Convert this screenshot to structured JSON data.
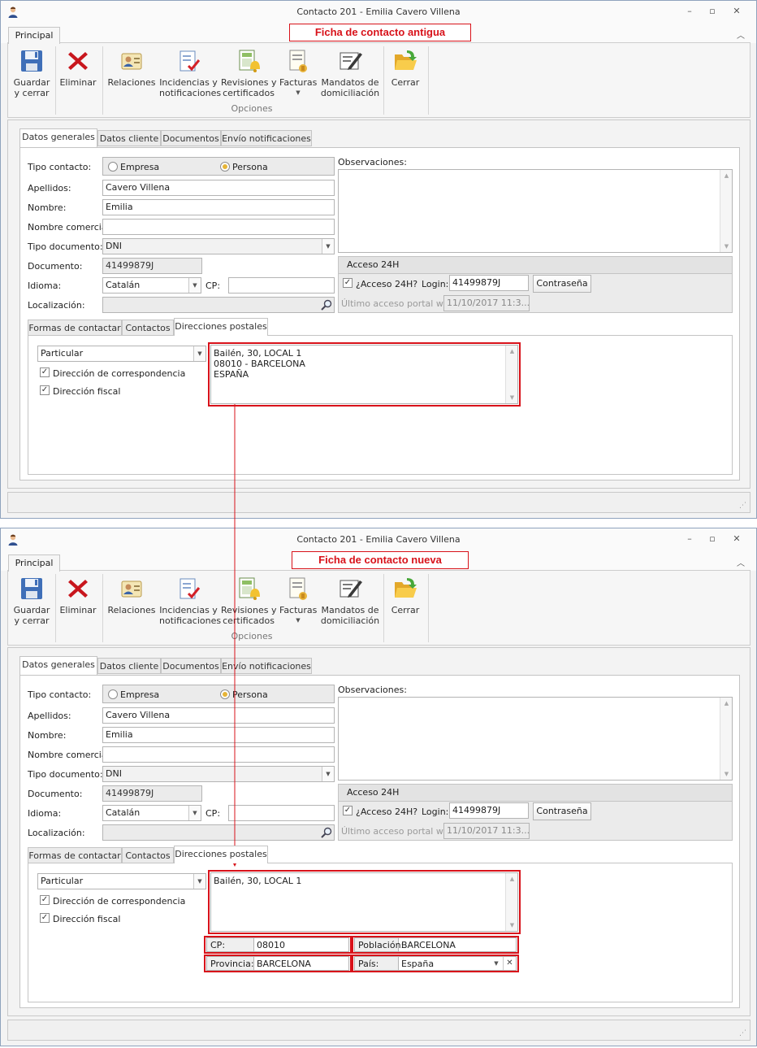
{
  "window_title": "Contacto 201 - Emilia Cavero Villena",
  "captions": {
    "old": "Ficha de contacto antigua",
    "new": "Ficha de contacto nueva"
  },
  "window_buttons": [
    "–",
    "▫",
    "✕"
  ],
  "ribbon": {
    "tab": "Principal",
    "buttons": {
      "save": "Guardar\ny cerrar",
      "delete": "Eliminar",
      "relations": "Relaciones",
      "incidents": "Incidencias y\nnotificaciones",
      "reviews": "Revisiones y\ncertificados",
      "invoices": "Facturas",
      "mandates": "Mandatos de\ndomiciliación",
      "close": "Cerrar"
    },
    "group_label": "Opciones",
    "icons": [
      "save-disk-icon",
      "delete-x-icon",
      "contact-card-icon",
      "checklist-icon",
      "calculator-bell-icon",
      "invoice-icon",
      "mandate-pen-icon",
      "folder-open-icon"
    ]
  },
  "tabs": [
    "Datos generales",
    "Datos cliente",
    "Documentos",
    "Envío notificaciones"
  ],
  "form": {
    "tipo_contacto_label": "Tipo contacto:",
    "opt_empresa": "Empresa",
    "opt_persona": "Persona",
    "apellidos_label": "Apellidos:",
    "apellidos": "Cavero Villena",
    "nombre_label": "Nombre:",
    "nombre": "Emilia",
    "nombre_comercial_label": "Nombre comercial:",
    "nombre_comercial": "",
    "tipo_documento_label": "Tipo documento:",
    "tipo_documento": "DNI",
    "documento_label": "Documento:",
    "documento": "41499879J",
    "idioma_label": "Idioma:",
    "idioma": "Catalán",
    "cp_label": "CP:",
    "cp": "",
    "localizacion_label": "Localización:",
    "observaciones_label": "Observaciones:"
  },
  "acceso": {
    "header": "Acceso 24H",
    "check_label": "¿Acceso 24H?",
    "login_label": "Login:",
    "login": "41499879J",
    "password_button": "Contraseña",
    "last_access_label": "Último acceso portal web:",
    "last_access": "11/10/2017 11:3..."
  },
  "subtabs": [
    "Formas de contactar",
    "Contactos",
    "Direcciones postales"
  ],
  "direcciones": {
    "tipo": "Particular",
    "correspondencia_label": "Dirección de correspondencia",
    "fiscal_label": "Dirección fiscal",
    "old_address": "Bailén, 30, LOCAL 1\n08010 - BARCELONA\nESPAÑA",
    "new_address": "Bailén, 30, LOCAL 1",
    "cp_label": "CP:",
    "cp": "08010",
    "poblacion_label": "Población:",
    "poblacion": "BARCELONA",
    "provincia_label": "Provincia:",
    "provincia": "BARCELONA",
    "pais_label": "País:",
    "pais": "España"
  },
  "colors": {
    "annotation_red": "#d8121a",
    "radio_selected": "#e6b437"
  }
}
